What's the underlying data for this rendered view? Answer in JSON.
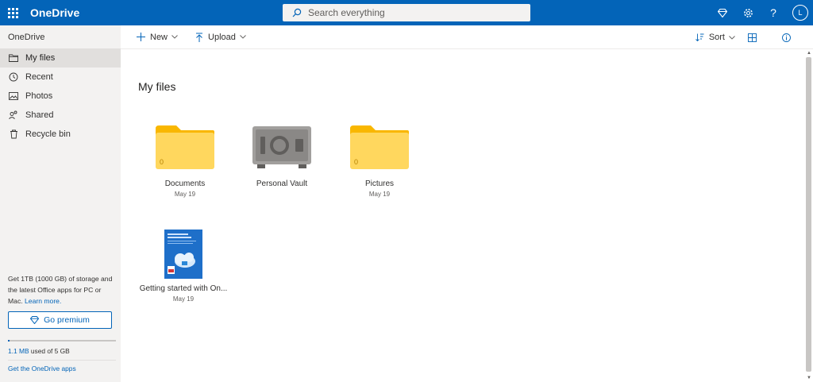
{
  "app": {
    "brand": "OneDrive"
  },
  "search": {
    "placeholder": "Search everything"
  },
  "top_icons": [
    "premium-diamond-icon",
    "gear-icon",
    "help-icon"
  ],
  "user": {
    "initial": "L"
  },
  "sidebar": {
    "title": "OneDrive",
    "items": [
      {
        "label": "My files",
        "icon": "folder-icon",
        "active": true
      },
      {
        "label": "Recent",
        "icon": "history-icon"
      },
      {
        "label": "Photos",
        "icon": "photo-icon"
      },
      {
        "label": "Shared",
        "icon": "people-icon"
      },
      {
        "label": "Recycle bin",
        "icon": "trash-icon"
      }
    ],
    "promo_text": "Get 1TB (1000 GB) of storage and the latest Office apps for PC or Mac.",
    "promo_link": "Learn more.",
    "premium_label": "Go premium",
    "storage_used": "1.1 MB",
    "storage_text": " used of 5 GB",
    "storage_fraction": 0.0002,
    "apps_link": "Get the OneDrive apps"
  },
  "commands": {
    "new_label": "New",
    "upload_label": "Upload",
    "sort_label": "Sort"
  },
  "main": {
    "heading": "My files",
    "items": [
      {
        "name": "Documents",
        "date": "May 19",
        "type": "folder",
        "count": "0"
      },
      {
        "name": "Personal Vault",
        "date": "",
        "type": "vault"
      },
      {
        "name": "Pictures",
        "date": "May 19",
        "type": "folder",
        "count": "0"
      },
      {
        "name": "Getting started with On...",
        "date": "May 19",
        "type": "pdf"
      }
    ]
  },
  "colors": {
    "brand_blue": "#0364b8",
    "folder_yellow": "#ffd75e",
    "folder_tab": "#f9b700"
  }
}
